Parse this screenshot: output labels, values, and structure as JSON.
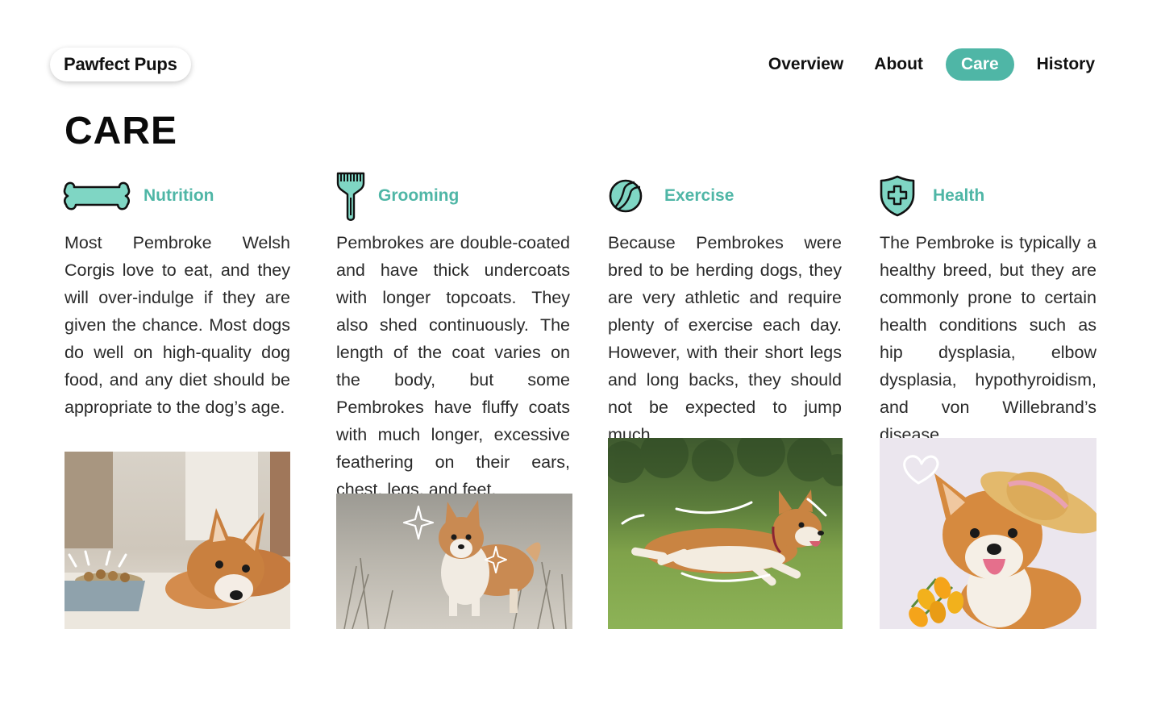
{
  "brand": {
    "name": "Pawfect Pups"
  },
  "nav": {
    "items": [
      {
        "label": "Overview"
      },
      {
        "label": "About"
      },
      {
        "label": "Care",
        "active": true
      },
      {
        "label": "History"
      }
    ]
  },
  "page": {
    "title": "CARE"
  },
  "sections": [
    {
      "title": "Nutrition",
      "icon": "bone-icon",
      "text": "Most Pembroke Welsh Corgis love to eat, and they will over-indulge if they are given the chance. Most dogs do well on high-quality dog food, and any diet should be appropriate to the dog’s age.",
      "image": "corgi-lying-by-food-bowl"
    },
    {
      "title": "Grooming",
      "icon": "comb-icon",
      "text": "Pembrokes are double-coated and have thick undercoats with longer topcoats. They also shed continuously. The length of the coat varies on the body, but some Pembrokes have fluffy coats with much longer, excessive feathering on their ears, chest, legs, and feet.",
      "image": "fluffy-corgi-on-sand"
    },
    {
      "title": "Exercise",
      "icon": "tennis-ball-icon",
      "text": "Because Pembrokes were bred to be herding dogs, they are very athletic and require plenty of exercise each day. However, with their short legs and long backs, they should not be expected to jump much.",
      "image": "corgi-running-on-grass"
    },
    {
      "title": "Health",
      "icon": "shield-plus-icon",
      "text": "The Pembroke is typically a healthy breed, but they are commonly prone to certain health conditions such as hip dysplasia, elbow dysplasia, hypothyroidism, and von Willebrand’s disease.",
      "image": "corgi-in-straw-hat"
    }
  ],
  "colors": {
    "accent": "#4fb6a6",
    "icon_fill": "#7fd6c4",
    "text": "#2a2a2a"
  }
}
